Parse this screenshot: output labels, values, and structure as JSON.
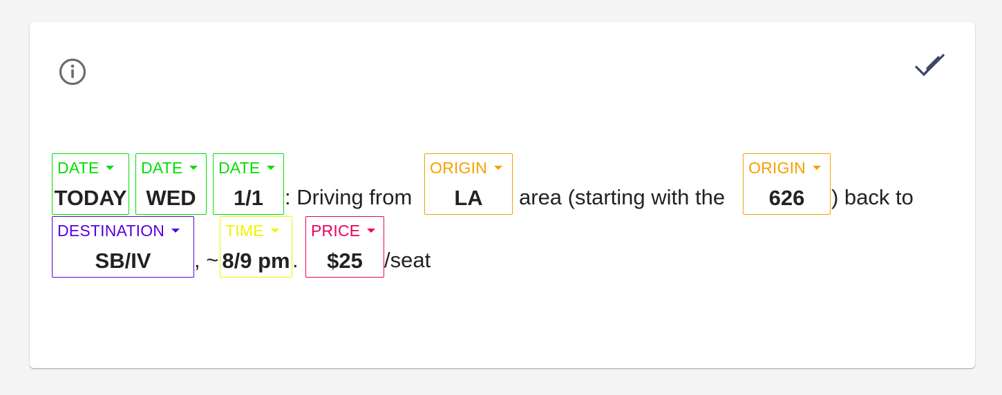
{
  "colors": {
    "date": "#00dd00",
    "origin": "#f5a000",
    "destination": "#5500dd",
    "time": "#f2f200",
    "price": "#e8005a"
  },
  "header": {
    "info_icon": "info-circle-icon",
    "confirm_icon": "double-check-icon"
  },
  "chips": {
    "date1": {
      "label": "DATE",
      "value": "TODAY"
    },
    "date2": {
      "label": "DATE",
      "value": "WED"
    },
    "date3": {
      "label": "DATE",
      "value": "1/1"
    },
    "origin1": {
      "label": "ORIGIN",
      "value": "LA"
    },
    "origin2": {
      "label": "ORIGIN",
      "value": "626"
    },
    "destination": {
      "label": "DESTINATION",
      "value": "SB/IV"
    },
    "time": {
      "label": "TIME",
      "value": "8/9 pm"
    },
    "price": {
      "label": "PRICE",
      "value": "$25"
    }
  },
  "text": {
    "t1": ": Driving from",
    "t2": "area (starting with the",
    "t3": ") back to",
    "t4": ", ~",
    "t5": ".",
    "t6": "/seat"
  }
}
